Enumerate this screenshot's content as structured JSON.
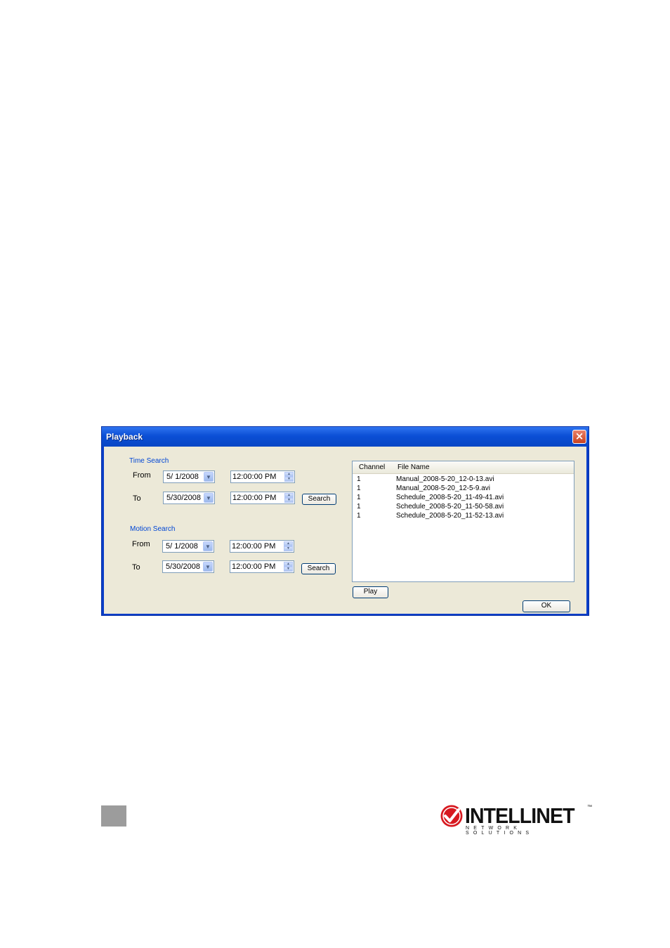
{
  "window": {
    "title": "Playback",
    "close_glyph": "×"
  },
  "time_search": {
    "group_label": "Time Search",
    "from_label": "From",
    "to_label": "To",
    "from_date": "5/  1/2008",
    "from_time": "12:00:00 PM",
    "to_date": "5/30/2008",
    "to_time": "12:00:00 PM",
    "search_label": "Search"
  },
  "motion_search": {
    "group_label": "Motion Search",
    "from_label": "From",
    "to_label": "To",
    "from_date": "5/  1/2008",
    "from_time": "12:00:00 PM",
    "to_date": "5/30/2008",
    "to_time": "12:00:00 PM",
    "search_label": "Search"
  },
  "file_list": {
    "columns": [
      "Channel",
      "File Name"
    ],
    "rows": [
      {
        "channel": "1",
        "file": "Manual_2008-5-20_12-0-13.avi"
      },
      {
        "channel": "1",
        "file": "Manual_2008-5-20_12-5-9.avi"
      },
      {
        "channel": "1",
        "file": "Schedule_2008-5-20_11-49-41.avi"
      },
      {
        "channel": "1",
        "file": "Schedule_2008-5-20_11-50-58.avi"
      },
      {
        "channel": "1",
        "file": "Schedule_2008-5-20_11-52-13.avi"
      }
    ]
  },
  "buttons": {
    "play": "Play",
    "ok": "OK"
  },
  "icons": {
    "dropdown": "chevron-down-icon",
    "spinner": "spin-updown-icon",
    "close": "close-icon",
    "logo_mark": "checkmark-circle-icon"
  },
  "colors": {
    "titlebar": "#0b4fd6",
    "close_button": "#c7411f",
    "group_label": "#0046d5",
    "dialog_face": "#ece9d8",
    "logo_red": "#d71920"
  },
  "logo": {
    "word": "INTELLINET",
    "tm": "™",
    "tagline": "NETWORK SOLUTIONS"
  }
}
